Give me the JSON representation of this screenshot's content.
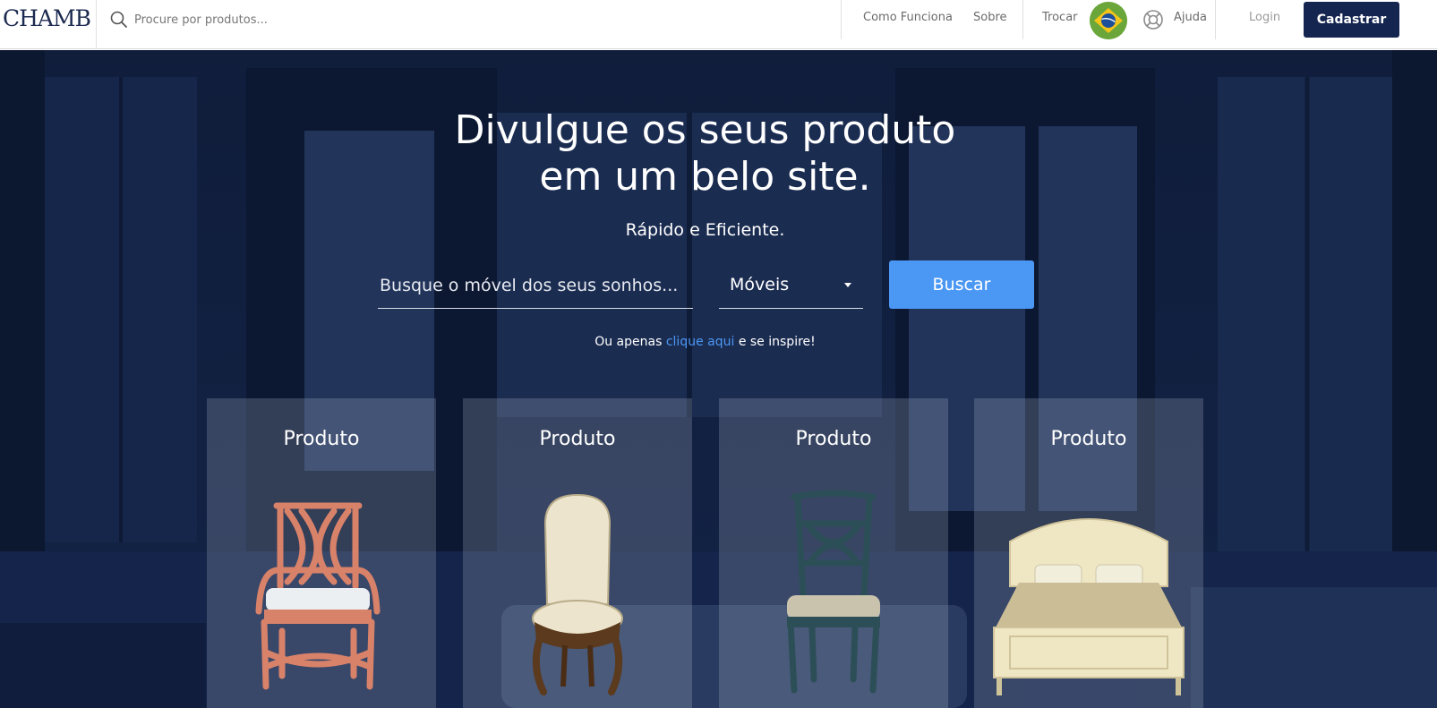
{
  "header": {
    "logo_text": "CHAMB",
    "search_placeholder": "Procure por produtos...",
    "nav": {
      "como_funciona": "Como Funciona",
      "sobre": "Sobre",
      "trocar": "Trocar",
      "ajuda": "Ajuda",
      "login": "Login",
      "cadastrar": "Cadastrar"
    }
  },
  "hero": {
    "title_line1": "Divulgue os seus produto",
    "title_line2": "em um belo site.",
    "subtitle": "Rápido e Eficiente.",
    "search_placeholder": "Busque o móvel dos seus sonhos...",
    "category_selected": "Móveis",
    "search_button": "Buscar",
    "hint_before": "Ou apenas",
    "hint_link": "clique aqui",
    "hint_after": "e se inspire!"
  },
  "products": [
    {
      "title": "Produto",
      "image": "salmon-armchair"
    },
    {
      "title": "Produto",
      "image": "upholstered-side-chair"
    },
    {
      "title": "Produto",
      "image": "teal-dining-chair"
    },
    {
      "title": "Produto",
      "image": "cream-bed"
    }
  ],
  "colors": {
    "brand_navy": "#142550",
    "accent_blue": "#4b97f4",
    "flag_green": "#6aa63a",
    "flag_yellow": "#f4c41a",
    "flag_blue": "#1d4f9a"
  }
}
